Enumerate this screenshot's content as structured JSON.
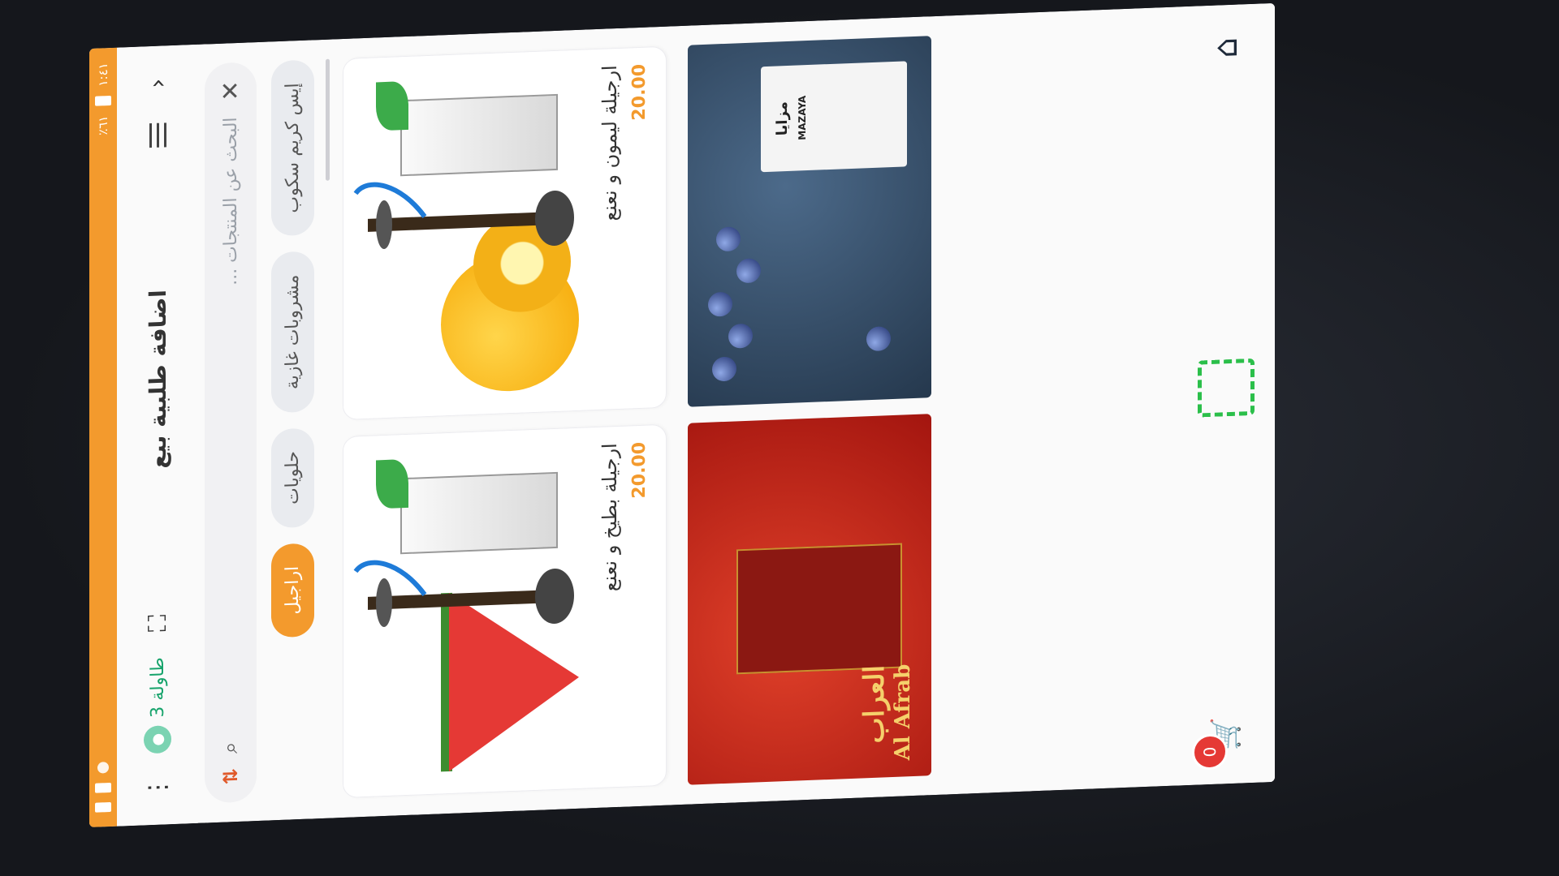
{
  "statusbar": {
    "time": "١:٤١",
    "battery": "٦١٪"
  },
  "appbar": {
    "title": "اضافة طلبية بيع",
    "table_label": "طاولة 3",
    "back_icon": "chevron-left-icon",
    "menu_icon": "hamburger-icon",
    "more_icon": "more-vert-icon",
    "expand_icon": "expand-icon"
  },
  "search": {
    "placeholder": "البحث عن المنتجات ...",
    "value": ""
  },
  "categories": [
    {
      "label": "إيس كريم سكوب",
      "active": false
    },
    {
      "label": "مشروبات غازية",
      "active": false
    },
    {
      "label": "حلويات",
      "active": false
    },
    {
      "label": "اراجيل",
      "active": true
    }
  ],
  "products": [
    {
      "name": "ارجيلة ليمون و نعنع",
      "price": "20.00"
    },
    {
      "name": "ارجيلة بطيخ و نعنع",
      "price": "20.00"
    }
  ],
  "banners": [
    {
      "brand_ar": "مزايا",
      "brand_en": "MAZAYA",
      "color": "#2f4560"
    },
    {
      "brand_ar": "العراب",
      "brand_en": "Al Afrab",
      "color": "#c0281b"
    }
  ],
  "bottombar": {
    "cart_count": "0",
    "home_icon": "home-icon",
    "qr_icon": "qr-scan-icon",
    "cart_icon": "cart-icon"
  },
  "colors": {
    "accent": "#f39a2d",
    "green": "#16a36b",
    "badge": "#e53935"
  }
}
